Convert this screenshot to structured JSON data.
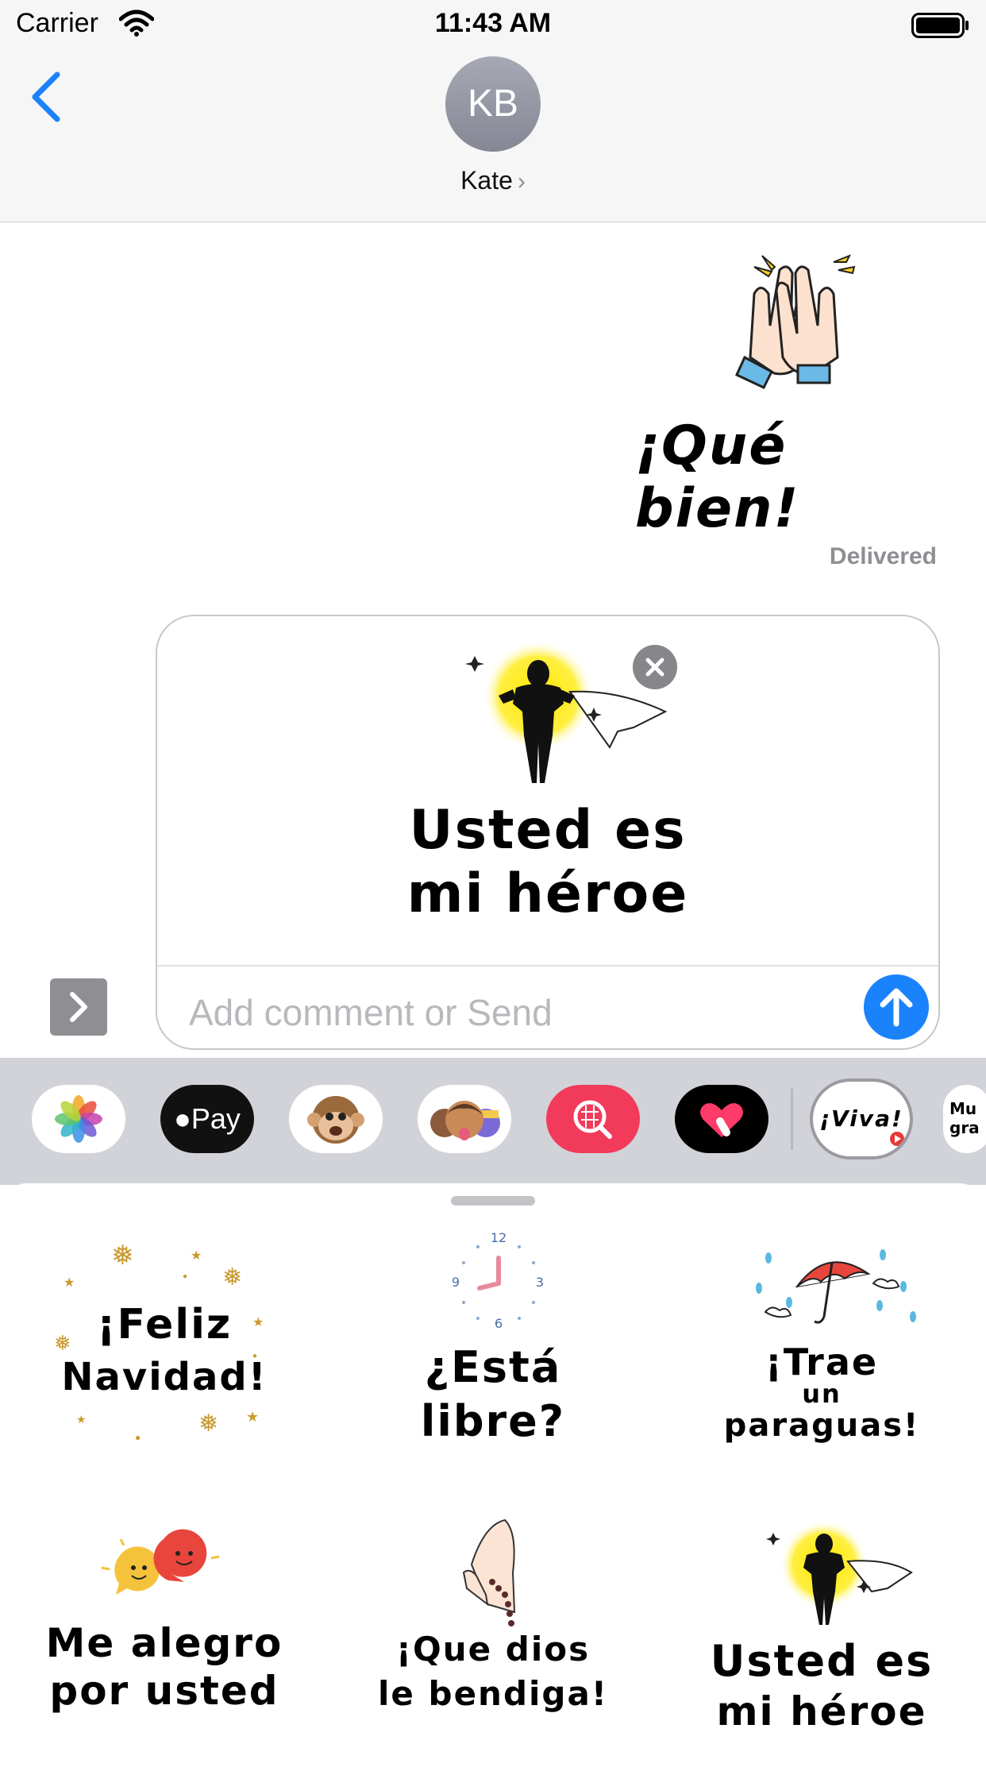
{
  "status_bar": {
    "carrier": "Carrier",
    "time": "11:43 AM"
  },
  "header": {
    "avatar_initials": "KB",
    "contact_name": "Kate"
  },
  "conversation": {
    "sent_sticker": {
      "text": "¡Qué bien!"
    },
    "delivery_status": "Delivered"
  },
  "compose": {
    "sticker_text_line1": "Usted es",
    "sticker_text_line2": "mi héroe",
    "placeholder": "Add comment or Send"
  },
  "app_strip": {
    "apps": [
      {
        "name": "Photos"
      },
      {
        "name": "Apple Pay",
        "label": "Pay"
      },
      {
        "name": "Animoji"
      },
      {
        "name": "Memoji"
      },
      {
        "name": "Search"
      },
      {
        "name": "Digital Touch"
      },
      {
        "name": "Sticker pack",
        "label": "¡Viva!"
      },
      {
        "name": "Sticker pack 2",
        "label": "Mu gra"
      }
    ]
  },
  "sticker_drawer": {
    "stickers": [
      {
        "line1": "¡Feliz",
        "line2": "Navidad!"
      },
      {
        "line1": "¿Está",
        "line2": "libre?"
      },
      {
        "line1": "¡Trae",
        "line2": "un",
        "line3": "paraguas!"
      },
      {
        "line1": "Me alegro",
        "line2": "por usted"
      },
      {
        "line1": "¡Que dios",
        "line2": "le bendiga!"
      },
      {
        "line1": "Usted es",
        "line2": "mi héroe"
      }
    ]
  },
  "colors": {
    "accent": "#1a82fb",
    "nav_bg": "#f6f6f7",
    "strip_bg": "#d1d3d9"
  }
}
